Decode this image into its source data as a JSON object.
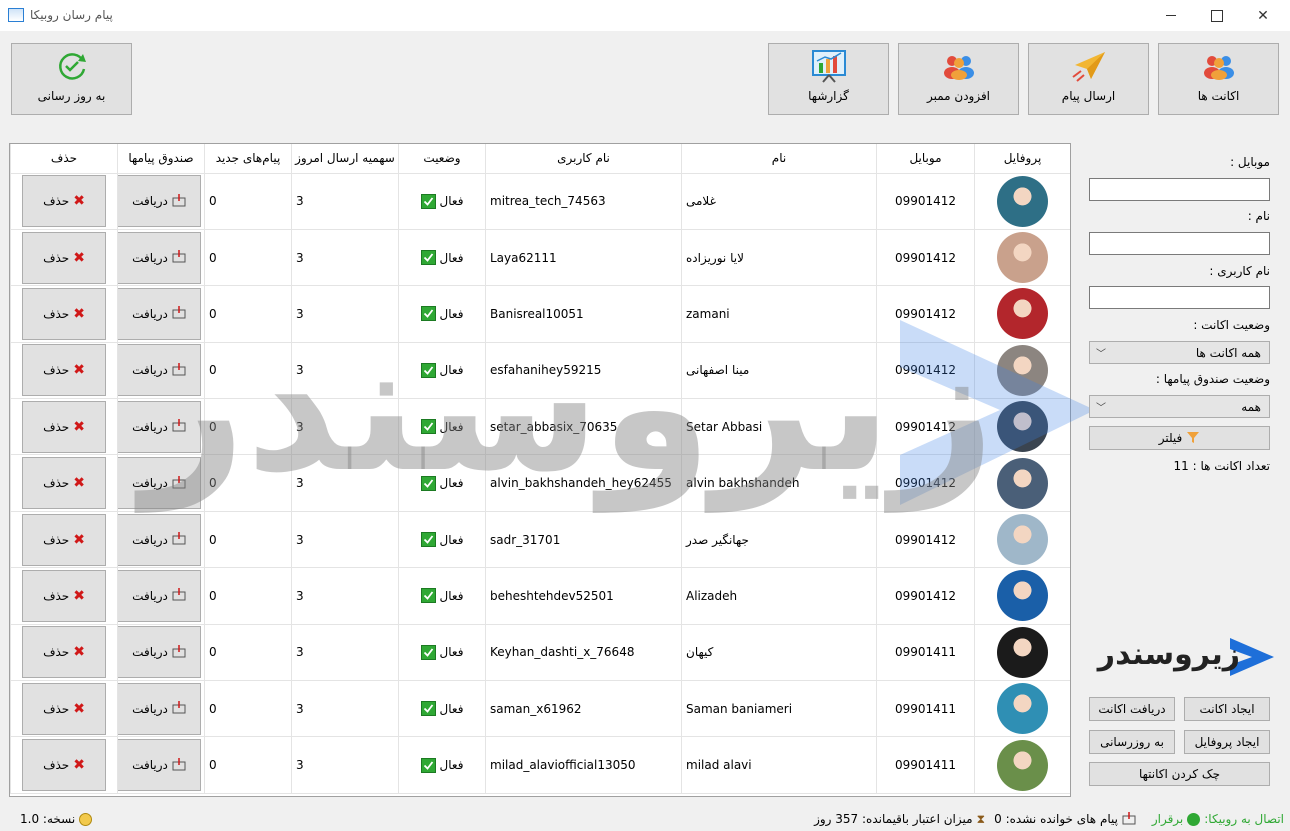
{
  "window": {
    "title": "پیام رسان روبیکا"
  },
  "toolbar": {
    "accounts": "اکانت ها",
    "send_message": "ارسال پیام",
    "add_member": "افزودن ممبر",
    "reports": "گزارشها",
    "update": "به روز رسانی"
  },
  "table": {
    "headers": {
      "profile": "پروفایل",
      "mobile": "موبایل",
      "name": "نام",
      "username": "نام کاربری",
      "status": "وضعیت",
      "quota": "سهمیه ارسال امروز",
      "new_messages": "پیام‌های جدید",
      "inbox": "صندوق پیامها",
      "delete": "حذف"
    },
    "receive_label": "دریافت",
    "delete_label": "حذف",
    "rows": [
      {
        "mobile": "09901412",
        "name": "غلامی",
        "username": "mitrea_tech_74563",
        "status": "فعال",
        "quota": "3",
        "new": "0",
        "avatar_color": "#2e6f86"
      },
      {
        "mobile": "09901412",
        "name": "لایا نوریزاده",
        "username": "Laya62111",
        "status": "فعال",
        "quota": "3",
        "new": "0",
        "avatar_color": "#c9a18c"
      },
      {
        "mobile": "09901412",
        "name": "zamani",
        "username": "Banisreal10051",
        "status": "فعال",
        "quota": "3",
        "new": "0",
        "avatar_color": "#b3262c"
      },
      {
        "mobile": "09901412",
        "name": "مینا اصفهانی",
        "username": "esfahanihey59215",
        "status": "فعال",
        "quota": "3",
        "new": "0",
        "avatar_color": "#8c8580"
      },
      {
        "mobile": "09901412",
        "name": "Setar Abbasi",
        "username": "setar_abbasix_70635",
        "status": "فعال",
        "quota": "3",
        "new": "0",
        "avatar_color": "#3a4450"
      },
      {
        "mobile": "09901412",
        "name": "alvin bakhshandeh",
        "username": "alvin_bakhshandeh_hey62455",
        "status": "فعال",
        "quota": "3",
        "new": "0",
        "avatar_color": "#4a5f78"
      },
      {
        "mobile": "09901412",
        "name": "جهانگیر صدر",
        "username": "sadr_31701",
        "status": "فعال",
        "quota": "3",
        "new": "0",
        "avatar_color": "#9fb7c9"
      },
      {
        "mobile": "09901412",
        "name": "Alizadeh",
        "username": "beheshtehdev52501",
        "status": "فعال",
        "quota": "3",
        "new": "0",
        "avatar_color": "#1a5fa8"
      },
      {
        "mobile": "09901411",
        "name": "کیهان",
        "username": "Keyhan_dashti_x_76648",
        "status": "فعال",
        "quota": "3",
        "new": "0",
        "avatar_color": "#1b1b1b"
      },
      {
        "mobile": "09901411",
        "name": "Saman baniameri",
        "username": "saman_x61962",
        "status": "فعال",
        "quota": "3",
        "new": "0",
        "avatar_color": "#2f8fb4"
      },
      {
        "mobile": "09901411",
        "name": "milad alavi",
        "username": "milad_alaviofficial13050",
        "status": "فعال",
        "quota": "3",
        "new": "0",
        "avatar_color": "#6a8f4a"
      }
    ]
  },
  "filters": {
    "mobile_label": "موبایل :",
    "name_label": "نام :",
    "username_label": "نام کاربری :",
    "account_status_label": "وضعیت اکانت :",
    "account_status_value": "همه اکانت ها",
    "inbox_status_label": "وضعیت صندوق پیامها :",
    "inbox_status_value": "همه",
    "filter_button": "فیلتر",
    "account_count": "تعداد اکانت ها : 11"
  },
  "watermark": {
    "text": "زیروسندر"
  },
  "logo": {
    "text": "زیروسندر"
  },
  "actions": {
    "create_account": "ایجاد اکانت",
    "get_account": "دریافت اکانت",
    "create_profile": "ایجاد پروفایل",
    "update": "به روزرسانی",
    "check_accounts": "چک کردن اکانتها"
  },
  "statusbar": {
    "connection": "اتصال به روبیکا:",
    "connection_state": "برقرار",
    "unread": "پیام های خوانده نشده: 0",
    "credit": "میزان اعتبار باقیمانده: 357 روز",
    "version": "نسخه: 1.0"
  },
  "colors": {
    "active": "#2fa834",
    "delete": "#d01818",
    "brand_blue": "#1e6fd9"
  }
}
